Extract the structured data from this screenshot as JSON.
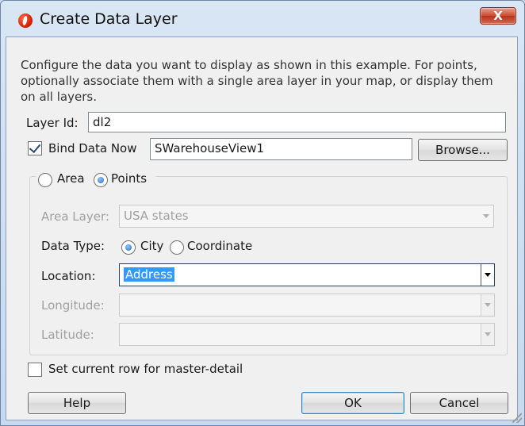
{
  "window": {
    "title": "Create Data Layer",
    "close_label": "X"
  },
  "description": "Configure the data you want to display as shown in this example. For points, optionally associate them with a single area layer in your map, or display them on all layers.",
  "layer_id": {
    "label": "Layer Id:",
    "value": "dl2"
  },
  "bind_data": {
    "label": "Bind Data Now",
    "checked": true,
    "value": "SWarehouseView1",
    "browse_label": "Browse..."
  },
  "layer_kind": {
    "area_label": "Area",
    "points_label": "Points",
    "selected": "Points"
  },
  "area_layer": {
    "label": "Area Layer:",
    "value": "USA states",
    "enabled": false
  },
  "data_type": {
    "label": "Data Type:",
    "city_label": "City",
    "coordinate_label": "Coordinate",
    "selected": "City"
  },
  "location": {
    "label": "Location:",
    "value": "Address"
  },
  "longitude": {
    "label": "Longitude:",
    "value": "",
    "enabled": false
  },
  "latitude": {
    "label": "Latitude:",
    "value": "",
    "enabled": false
  },
  "master_detail": {
    "label": "Set current row for master-detail",
    "checked": false
  },
  "buttons": {
    "help": "Help",
    "ok": "OK",
    "cancel": "Cancel"
  }
}
